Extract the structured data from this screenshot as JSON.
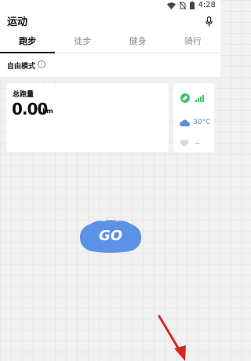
{
  "status_bar": {
    "time": "4:28"
  },
  "header": {
    "title": "运动",
    "mic_icon": "microphone-icon"
  },
  "tabs": [
    {
      "label": "跑步",
      "active": true
    },
    {
      "label": "徒步",
      "active": false
    },
    {
      "label": "健身",
      "active": false
    },
    {
      "label": "骑行",
      "active": false
    }
  ],
  "mode": {
    "label": "自由模式",
    "info_icon": "info-icon"
  },
  "stats": {
    "title": "总跑量",
    "value": "0.00",
    "unit": "km"
  },
  "side": {
    "gps_icon": "gps-satellite-icon",
    "signal_bars": 4,
    "weather_icon": "cloud-icon",
    "temperature": "30°C",
    "heart_icon": "heart-icon",
    "heart_rate": "--"
  },
  "go_button": {
    "label": "GO"
  },
  "colors": {
    "accent_blue": "#5b92e5",
    "signal_green": "#3fc36a",
    "gps_green": "#3fc36a",
    "arrow_red": "#d42a24",
    "background": "#f1f1f1"
  }
}
